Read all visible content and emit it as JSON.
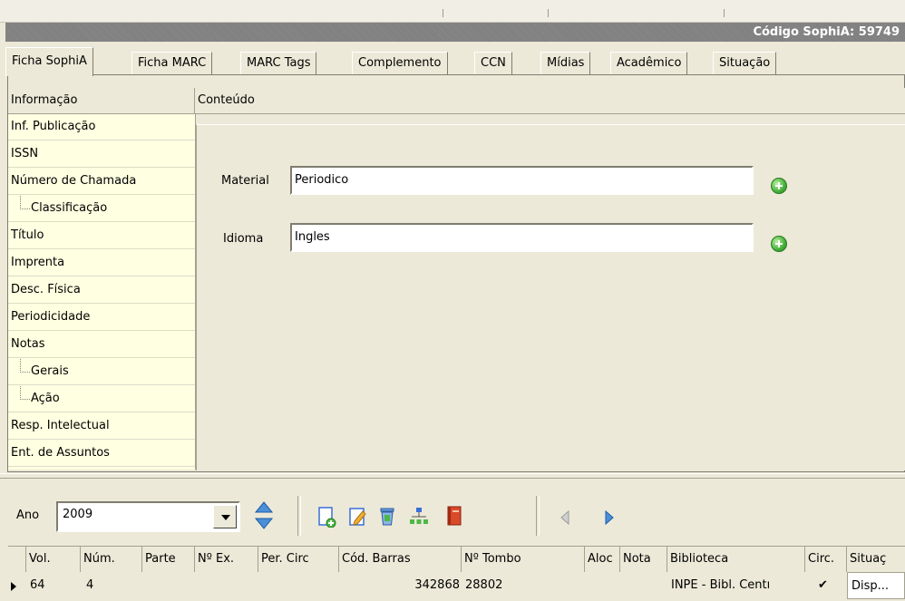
{
  "title_bar": {
    "codigo_label": "Código SophiA: 59749"
  },
  "tabs": [
    {
      "label": "Ficha SophiA",
      "active": true
    },
    {
      "label": "Ficha MARC"
    },
    {
      "label": "MARC Tags"
    },
    {
      "label": "Complemento"
    },
    {
      "label": "CCN"
    },
    {
      "label": "Mídias"
    },
    {
      "label": "Acadêmico"
    },
    {
      "label": "Situação"
    }
  ],
  "grid_header": {
    "col1": "Informação",
    "col2": "Conteúdo"
  },
  "tree": [
    {
      "label": "Inf. Publicação"
    },
    {
      "label": "ISSN"
    },
    {
      "label": "Número de Chamada"
    },
    {
      "label": "Classificação"
    },
    {
      "label": "Título"
    },
    {
      "label": "Imprenta"
    },
    {
      "label": "Desc. Física"
    },
    {
      "label": "Periodicidade"
    },
    {
      "label": "Notas"
    },
    {
      "label": "Gerais"
    },
    {
      "label": "Ação"
    },
    {
      "label": "Resp. Intelectual"
    },
    {
      "label": "Ent. de Assuntos"
    }
  ],
  "form": {
    "material_label": "Material",
    "material_value": "Periodico",
    "idioma_label": "Idioma",
    "idioma_value": "Ingles",
    "add_icon": "add-circle-icon"
  },
  "toolbar": {
    "ano_label": "Ano",
    "ano_value": "2009",
    "icons": [
      "sort-updown-icon",
      "new-document-icon",
      "edit-icon",
      "delete-bin-icon",
      "hierarchy-icon",
      "book-icon",
      "prev-arrow-icon",
      "next-arrow-icon"
    ]
  },
  "bottom_grid": {
    "headers": [
      "Vol.",
      "Núm.",
      "Parte",
      "Nº Ex.",
      "Per. Circ",
      "Cód. Barras",
      "Nº Tombo",
      "Aloc",
      "Nota",
      "Biblioteca",
      "Circ.",
      "Situaç"
    ],
    "row": {
      "vol": "64",
      "num": "4",
      "cod_barras": "342868",
      "tombo": "28802",
      "biblioteca": "INPE - Bibl. Centı",
      "circ": "✔",
      "situacao": "Disp..."
    }
  },
  "colors": {
    "tree_bg": "#ffffe1",
    "window_bg": "#ece9d8",
    "accent": "#3a6fd8"
  }
}
